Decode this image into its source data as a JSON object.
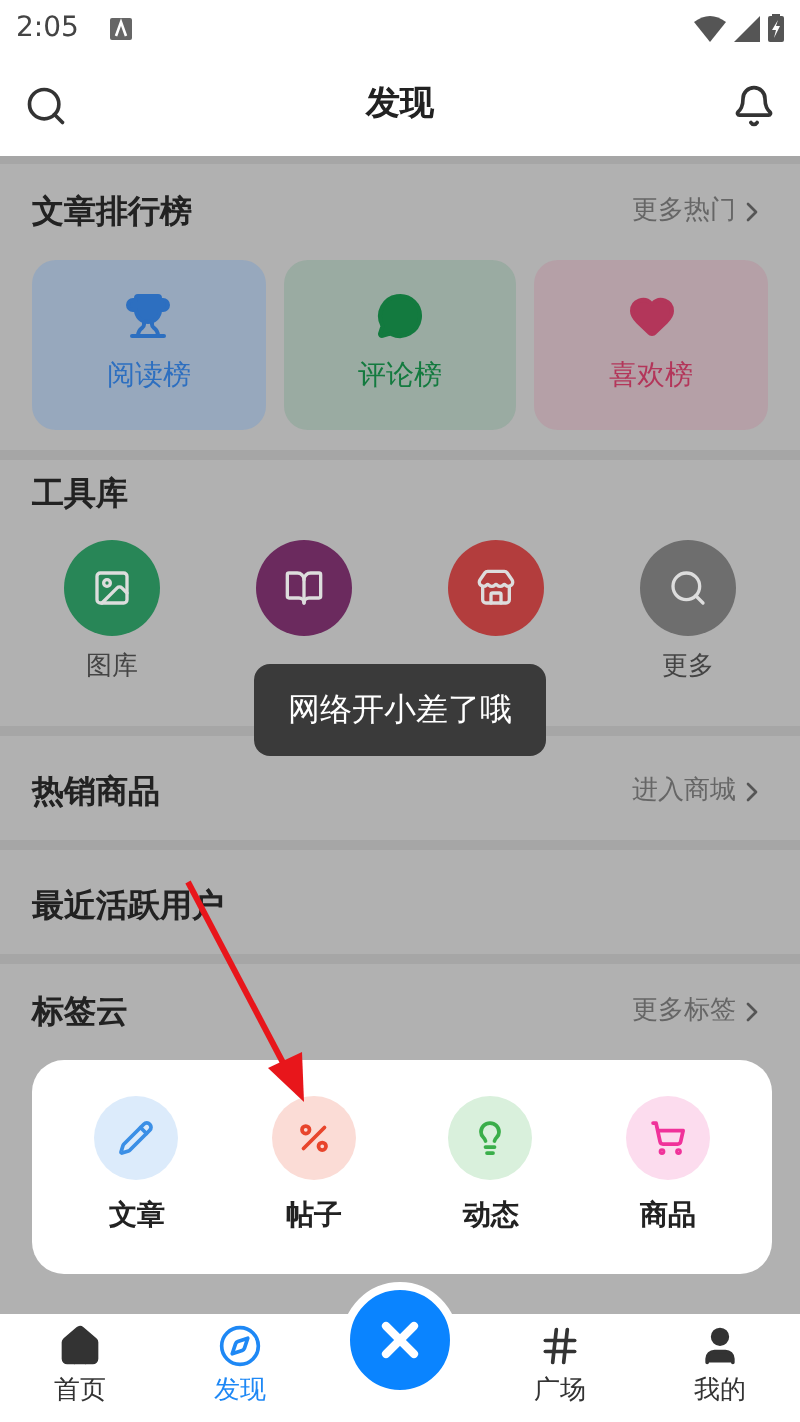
{
  "status_bar": {
    "time": "2:05"
  },
  "header": {
    "title": "发现"
  },
  "ranking": {
    "title": "文章排行榜",
    "more": "更多热门",
    "cards": [
      {
        "kind": "read",
        "label": "阅读榜"
      },
      {
        "kind": "comment",
        "label": "评论榜"
      },
      {
        "kind": "like",
        "label": "喜欢榜"
      }
    ]
  },
  "tools": {
    "title": "工具库",
    "items": [
      {
        "kind": "gallery",
        "label": "图库"
      },
      {
        "kind": "book"
      },
      {
        "kind": "shop"
      },
      {
        "kind": "more",
        "label": "更多"
      }
    ]
  },
  "hot_goods": {
    "title": "热销商品",
    "more": "进入商城"
  },
  "active_users": {
    "title": "最近活跃用户"
  },
  "tag_cloud": {
    "title": "标签云",
    "more": "更多标签"
  },
  "toast": "网络开小差了哦",
  "publish_menu": [
    {
      "kind": "article",
      "label": "文章"
    },
    {
      "kind": "post",
      "label": "帖子"
    },
    {
      "kind": "moment",
      "label": "动态"
    },
    {
      "kind": "goods",
      "label": "商品"
    }
  ],
  "bottom_nav": [
    {
      "kind": "home",
      "label": "首页",
      "selected": false
    },
    {
      "kind": "discover",
      "label": "发现",
      "selected": true
    },
    {
      "kind": "close"
    },
    {
      "kind": "square",
      "label": "广场",
      "selected": false
    },
    {
      "kind": "me",
      "label": "我的",
      "selected": false
    }
  ]
}
